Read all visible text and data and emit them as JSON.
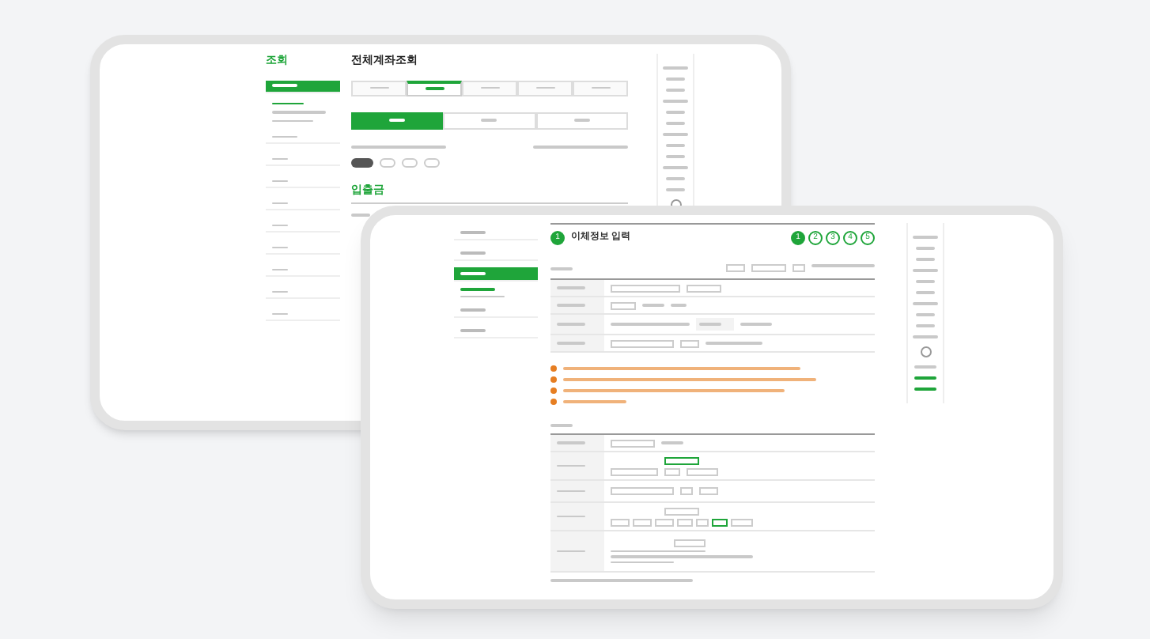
{
  "back_screen": {
    "sidebar_title": "조회",
    "title": "전체계좌조회",
    "sidebar_items": [
      {
        "selected": true
      },
      {
        "selected": false
      },
      {
        "selected": false
      },
      {
        "selected": false
      },
      {
        "selected": false
      },
      {
        "selected": false
      },
      {
        "selected": false
      },
      {
        "selected": false
      },
      {
        "selected": false
      },
      {
        "selected": false
      }
    ],
    "tabs": [
      {
        "selected": false
      },
      {
        "selected": true
      },
      {
        "selected": false
      },
      {
        "selected": false
      },
      {
        "selected": false
      }
    ],
    "segments": [
      {
        "selected": true
      },
      {
        "selected": false
      },
      {
        "selected": false
      }
    ],
    "section_title": "입출금"
  },
  "front_screen": {
    "title": "이체정보 입력",
    "title_step": "1",
    "steps": [
      {
        "label": "1",
        "selected": true
      },
      {
        "label": "2",
        "selected": false
      },
      {
        "label": "3",
        "selected": false
      },
      {
        "label": "4",
        "selected": false
      },
      {
        "label": "5",
        "selected": false
      }
    ],
    "sidebar_items": [
      {
        "selected": false
      },
      {
        "selected": false
      },
      {
        "selected": true
      },
      {
        "selected": false
      },
      {
        "selected": false
      }
    ]
  }
}
